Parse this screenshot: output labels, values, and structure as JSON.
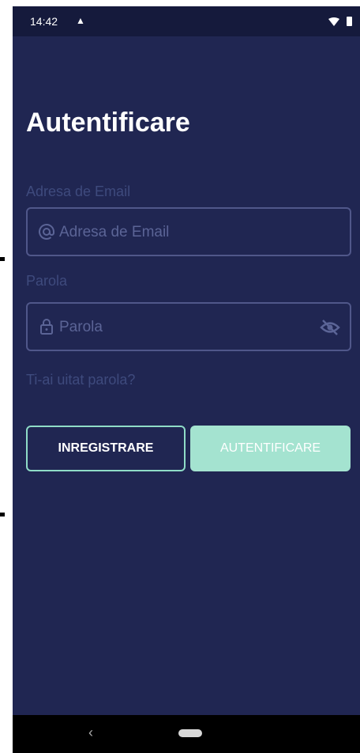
{
  "status_bar": {
    "time": "14:42",
    "notification_icon": "download-notification-icon",
    "wifi_icon": "wifi-icon",
    "battery_icon": "battery-icon"
  },
  "page": {
    "title": "Autentificare"
  },
  "email": {
    "label": "Adresa de Email",
    "placeholder": "Adresa de Email",
    "icon": "at-icon"
  },
  "password": {
    "label": "Parola",
    "placeholder": "Parola",
    "icon": "lock-icon",
    "toggle_icon": "eye-off-icon"
  },
  "links": {
    "forgot_password": "Ti-ai uitat parola?"
  },
  "buttons": {
    "register": "INREGISTRARE",
    "login": "AUTENTIFICARE"
  },
  "nav_bar": {
    "back": "‹"
  },
  "colors": {
    "background": "#202652",
    "accent": "#a4e3d0",
    "accent_border": "#8fdcc7"
  }
}
